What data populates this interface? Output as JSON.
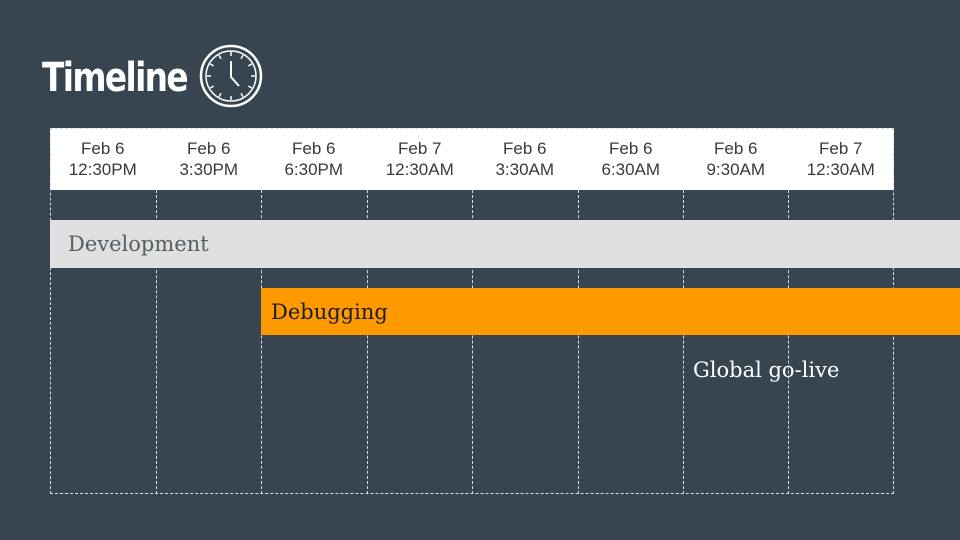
{
  "title": "Timeline",
  "columns": [
    {
      "date": "Feb 6",
      "time": "12:30PM"
    },
    {
      "date": "Feb 6",
      "time": "3:30PM"
    },
    {
      "date": "Feb 6",
      "time": "6:30PM"
    },
    {
      "date": "Feb 7",
      "time": "12:30AM"
    },
    {
      "date": "Feb 6",
      "time": "3:30AM"
    },
    {
      "date": "Feb 6",
      "time": "6:30AM"
    },
    {
      "date": "Feb 6",
      "time": "9:30AM"
    },
    {
      "date": "Feb 7",
      "time": "12:30AM"
    }
  ],
  "tasks": {
    "development": "Development",
    "debugging": "Debugging"
  },
  "milestone": "Global go-live",
  "colors": {
    "background": "#36454f",
    "development_bar": "#e0e0e0",
    "debugging_bar": "#ff9900"
  },
  "icons": {
    "title_icon": "clock-icon"
  }
}
